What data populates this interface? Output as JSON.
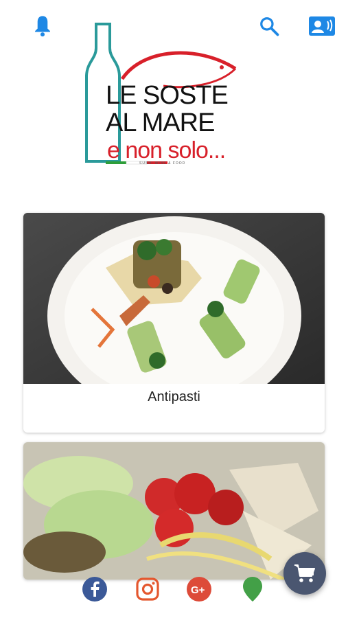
{
  "header": {
    "notifications_icon": "bell-icon",
    "search_icon": "search-icon",
    "contact_icon": "contact-card-icon",
    "accent_color": "#1e88e5"
  },
  "logo": {
    "line1": "LE SOSTE",
    "line2": "AL MARE",
    "line3": "e non solo...",
    "small_text": "SUSHI WINE & FOOD"
  },
  "categories": [
    {
      "label": "Antipasti"
    },
    {
      "label": ""
    }
  ],
  "social": {
    "facebook_icon": "facebook-icon",
    "instagram_icon": "instagram-icon",
    "googleplus_icon": "google-plus-icon",
    "location_icon": "map-pin-icon"
  },
  "cart": {
    "icon": "cart-icon",
    "color": "#4a5670"
  }
}
